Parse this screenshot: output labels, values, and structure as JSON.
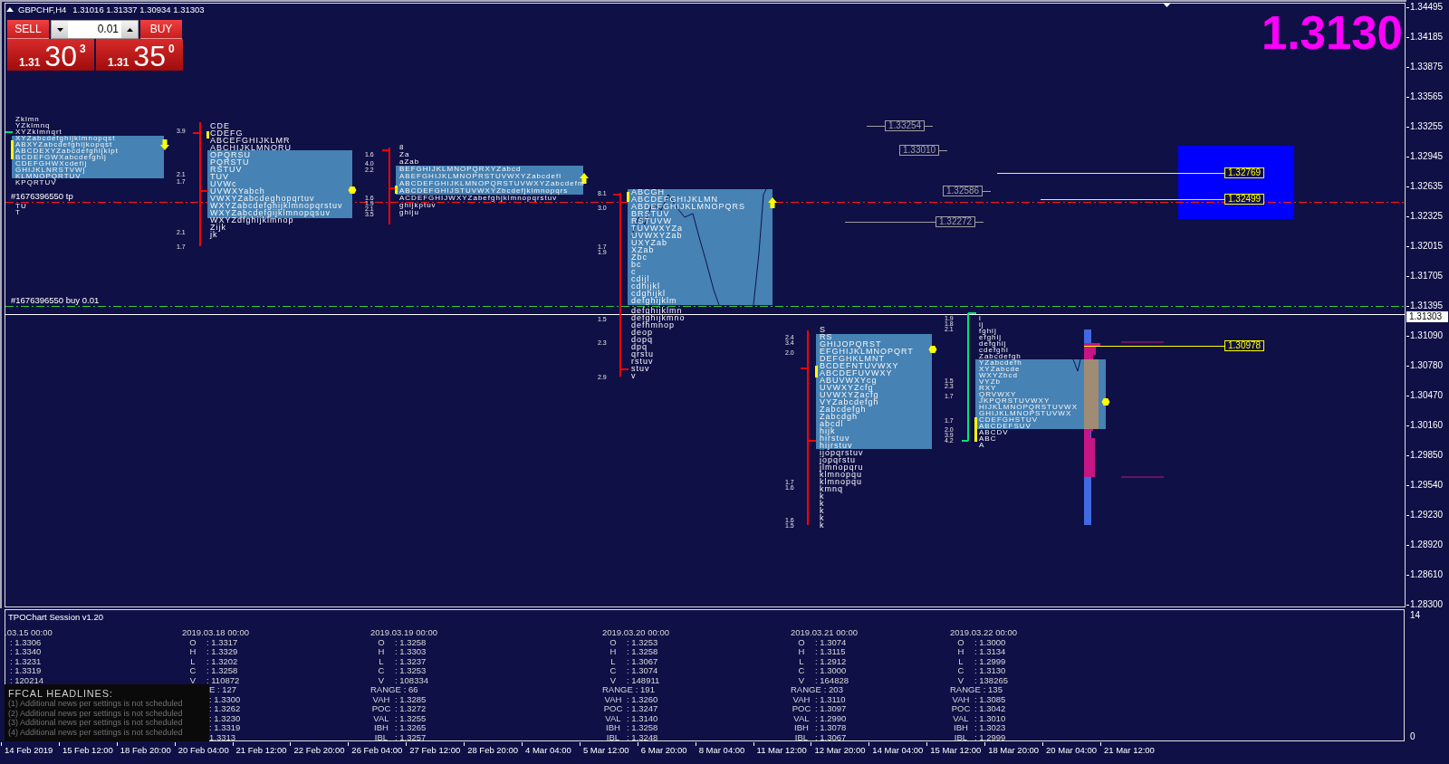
{
  "chart": {
    "symbol": "GBPCHF,H4",
    "ohlc": "1.31016 1.31337 1.30934 1.31303",
    "price": "1.3130"
  },
  "trade_panel": {
    "sell": {
      "label": "SELL",
      "prefix": "1.31",
      "digits": "30",
      "sup": "3"
    },
    "lot": "0.01",
    "buy": {
      "label": "BUY",
      "prefix": "1.31",
      "digits": "35",
      "sup": "0"
    }
  },
  "order_lines": [
    {
      "kind": "take_profit",
      "label": "#1676396550 tp"
    },
    {
      "kind": "entry",
      "label": "#1676396550 buy 0.01"
    }
  ],
  "tpo_sessions": [
    {
      "marker": {
        "kind": "down"
      },
      "rows": [
        "Zklmn",
        "YZklmnq",
        "XYZklmnqrt",
        "XYZabcdefghijklmnopqst",
        "ABXYZabcdefghijkopqst",
        "ABCDEXYZabcdefghijklpt",
        "BCDEFGWXabcdefghij",
        "CDEFGHWXcdefij",
        "GHIJKLNRSTVWj",
        "KLMNOPQRTUV",
        "KPQRTUV",
        "TU",
        "T"
      ]
    },
    {
      "color": "#ff0000",
      "marker": {
        "kind": "dot"
      },
      "numbers": [
        "3.9",
        "2.1",
        "1.7",
        "2.1",
        "1.7"
      ],
      "rows": [
        "CDE",
        "CDEFG",
        "ABCEFGHIJKLMR",
        "ABCHIJKLMNORU",
        "OPQRSU",
        "PQRSTU",
        "RSTUV",
        "TUV",
        "UVWc",
        "UVWXYabch",
        "VWXYZabcdeghopqrtuv",
        "WXYZabcdefghijklmnopqrstuv",
        "WXYZabcdefgijklmnopqsuv",
        "WXYZdfghijklmnop",
        "Zijk",
        "jk"
      ]
    },
    {
      "color": "#ff0000",
      "marker": {
        "kind": "up"
      },
      "numbers": [
        "1.6",
        "4.0",
        "2.2",
        "1.6",
        "1.9",
        "2.1",
        "3.5"
      ],
      "rows": [
        "8",
        "Za",
        "aZab",
        "BEFGHIJKLMNOPQRXYZabcd",
        "ABEFGHIJKLMNOPRSTUVWXYZabcdefl",
        "ABCDEFGHIJKLMNOPQRSTUVWXYZabcdefm",
        "ABCDEFGHIJSTUVWXYZbcdefjklmnopqrs",
        "ACDEFGHIJWXYZabefghjklmnopqrstuv",
        "ghijkptuv",
        "ghiju"
      ]
    },
    {
      "color": "#ff0000",
      "marker": {
        "kind": "up"
      },
      "numbers": [
        "8.1",
        "3.0",
        "1.7",
        "1.9",
        "1.5",
        "2.3",
        "2.9"
      ],
      "rows": [
        "ABCGH",
        "ABCDEFGHIJKLMN",
        "ABDEFGHIJKLMNOPQRS",
        "BRSTUV",
        "RSTUVW",
        "TUVWXYZa",
        "UVWXYZab",
        "UXYZab",
        "XZab",
        "Zbc",
        "bc",
        "c",
        "cdijl",
        "cdhijkl",
        "cdghijkl",
        "defghijklm",
        "defghijklmn",
        "defghijkmno",
        "defhmnop",
        "deop",
        "dopq",
        "dpq",
        "qrstu",
        "rstuv",
        "stuv",
        "v"
      ]
    },
    {
      "color": "#ff0000",
      "marker": {
        "kind": "dot"
      },
      "numbers": [
        "2.4",
        "3.4",
        "2.0",
        "1.7",
        "1.6",
        "1.6",
        "1.5"
      ],
      "rows": [
        "S",
        "RS",
        "GHIJOPQRST",
        "EFGHIJKLMNOPQRT",
        "DEFGHKLMNT",
        "BCDEFNTUVWXY",
        "ABCDEFUVWXY",
        "ABUVWXYcg",
        "UVWXYZcfg",
        "UVWXYZacfg",
        "VYZabcdefgh",
        "Zabcdefgh",
        "Zabcdgh",
        "abcdl",
        "hijk",
        "hirstuv",
        "hijrstuv",
        "ijopqrstuv",
        "jopqrstu",
        "jlmnopqru",
        "klmnopqu",
        "klmnopqu",
        "kmnq",
        "k",
        "k",
        "k",
        "k",
        "k"
      ]
    },
    {
      "color": "#00e676",
      "marker": {
        "kind": "dot"
      },
      "numbers": [
        "1.9",
        "1.8",
        "2.1",
        "1.5",
        "2.3",
        "1.7",
        "1.7",
        "2.0",
        "3.9",
        "4.2"
      ],
      "rows": [
        "i",
        "ij",
        "fghij",
        "efghij",
        "defghij",
        "cdefghi",
        "Zabcdefgh",
        "YZabcdefh",
        "XYZabcde",
        "WXYZbcd",
        "VYZb",
        "RXY",
        "QRVWXY",
        "JKPQRSTUVWXY",
        "HIJKLMNOPQRSTUVWX",
        "GHIJKLMNOPSTUVWX",
        "CDEFGHSTUV",
        "ABCDEFSUV",
        "ABCDV",
        "ABC",
        "A"
      ]
    }
  ],
  "price_levels": [
    {
      "text": "1.33254",
      "color": "#a0a0a0"
    },
    {
      "text": "1.33010",
      "color": "#a0a0a0"
    },
    {
      "text": "1.32586",
      "color": "#a0a0a0"
    },
    {
      "text": "1.32272",
      "color": "#a0a0a0"
    },
    {
      "text": "1.32769",
      "color": "#ffff00"
    },
    {
      "text": "1.32499",
      "color": "#ffff00"
    },
    {
      "text": "1.30978",
      "color": "#ffff00"
    }
  ],
  "price_axis": {
    "labels": [
      "1.34495",
      "1.34185",
      "1.33875",
      "1.33565",
      "1.33255",
      "1.32945",
      "1.32635",
      "1.32325",
      "1.32015",
      "1.31705",
      "1.31395",
      "1.31090",
      "1.30780",
      "1.30470",
      "1.30160",
      "1.29850",
      "1.29540",
      "1.29230",
      "1.28920",
      "1.28610",
      "1.28300"
    ],
    "current": "1.31303"
  },
  "indicator": {
    "title": "TPOChart Session v1.20",
    "sessions": [
      {
        "date": ".03.15 00:00",
        "rows": [
          {
            "value": ": 1.3306"
          },
          {
            "value": ": 1.3340"
          },
          {
            "value": ": 1.3231"
          },
          {
            "value": ": 1.3319"
          },
          {
            "value": ": 120214"
          }
        ]
      },
      {
        "date": "2019.03.18 00:00",
        "rows": [
          {
            "label": "O",
            "value": ": 1.3317"
          },
          {
            "label": "H",
            "value": ": 1.3329"
          },
          {
            "label": "L",
            "value": ": 1.3202"
          },
          {
            "label": "C",
            "value": ": 1.3258"
          },
          {
            "label": "V",
            "value": ": 110872"
          },
          {
            "value": "E : 127"
          },
          {
            "value": ": 1.3300"
          },
          {
            "value": ": 1.3262"
          },
          {
            "value": ": 1.3230"
          },
          {
            "value": ": 1.3319"
          },
          {
            "value": "1.3313"
          }
        ]
      },
      {
        "date": "2019.03.19 00:00",
        "rows": [
          {
            "label": "O",
            "value": ": 1.3258"
          },
          {
            "label": "H",
            "value": ": 1.3303"
          },
          {
            "label": "L",
            "value": ": 1.3237"
          },
          {
            "label": "C",
            "value": ": 1.3253"
          },
          {
            "label": "V",
            "value": ": 108334"
          },
          {
            "label": "RANGE",
            "value": ": 66"
          },
          {
            "label": "VAH",
            "value": ": 1.3285"
          },
          {
            "label": "POC",
            "value": ": 1.3272"
          },
          {
            "label": "VAL",
            "value": ": 1.3255"
          },
          {
            "label": "IBH",
            "value": ": 1.3265"
          },
          {
            "label": "IBL",
            "value": ": 1.3257"
          }
        ]
      },
      {
        "date": "2019.03.20 00:00",
        "rows": [
          {
            "label": "O",
            "value": ": 1.3253"
          },
          {
            "label": "H",
            "value": ": 1.3258"
          },
          {
            "label": "L",
            "value": ": 1.3067"
          },
          {
            "label": "C",
            "value": ": 1.3074"
          },
          {
            "label": "V",
            "value": ": 148911"
          },
          {
            "label": "RANGE",
            "value": ": 191"
          },
          {
            "label": "VAH",
            "value": ": 1.3260"
          },
          {
            "label": "POC",
            "value": ": 1.3247"
          },
          {
            "label": "VAL",
            "value": ": 1.3140"
          },
          {
            "label": "IBH",
            "value": ": 1.3258"
          },
          {
            "label": "IBL",
            "value": ": 1.3248"
          }
        ]
      },
      {
        "date": "2019.03.21 00:00",
        "rows": [
          {
            "label": "O",
            "value": ": 1.3074"
          },
          {
            "label": "H",
            "value": ": 1.3115"
          },
          {
            "label": "L",
            "value": ": 1.2912"
          },
          {
            "label": "C",
            "value": ": 1.3000"
          },
          {
            "label": "V",
            "value": ": 164828"
          },
          {
            "label": "RANGE",
            "value": ": 203"
          },
          {
            "label": "VAH",
            "value": ": 1.3110"
          },
          {
            "label": "POC",
            "value": ": 1.3097"
          },
          {
            "label": "VAL",
            "value": ": 1.2990"
          },
          {
            "label": "IBH",
            "value": ": 1.3078"
          },
          {
            "label": "IBL",
            "value": ": 1.3067"
          }
        ]
      },
      {
        "date": "2019.03.22 00:00",
        "rows": [
          {
            "label": "O",
            "value": ": 1.3000"
          },
          {
            "label": "H",
            "value": ": 1.3134"
          },
          {
            "label": "L",
            "value": ": 1.2999"
          },
          {
            "label": "C",
            "value": ": 1.3130"
          },
          {
            "label": "V",
            "value": ": 138265"
          },
          {
            "label": "RANGE",
            "value": ": 135"
          },
          {
            "label": "VAH",
            "value": ": 1.3085"
          },
          {
            "label": "POC",
            "value": ": 1.3042"
          },
          {
            "label": "VAL",
            "value": ": 1.3010"
          },
          {
            "label": "IBH",
            "value": ": 1.3023"
          },
          {
            "label": "IBL",
            "value": ": 1.2999"
          }
        ]
      }
    ],
    "news": {
      "title": "FFCAL HEADLINES:",
      "items": [
        "(1) Additional news per settings is not scheduled",
        "(2) Additional news per settings is not scheduled",
        "(3) Additional news per settings is not scheduled",
        "(4) Additional news per settings is not scheduled"
      ]
    },
    "axis": [
      "14",
      "0"
    ]
  },
  "time_axis": [
    "14 Feb 2019",
    "15 Feb 12:00",
    "18 Feb 20:00",
    "20 Feb 04:00",
    "21 Feb 12:00",
    "22 Feb 20:00",
    "26 Feb 04:00",
    "27 Feb 12:00",
    "28 Feb 20:00",
    "4 Mar 04:00",
    "5 Mar 12:00",
    "6 Mar 20:00",
    "8 Mar 04:00",
    "11 Mar 12:00",
    "12 Mar 20:00",
    "14 Mar 04:00",
    "15 Mar 12:00",
    "18 Mar 20:00",
    "20 Mar 04:00",
    "21 Mar 12:00"
  ]
}
